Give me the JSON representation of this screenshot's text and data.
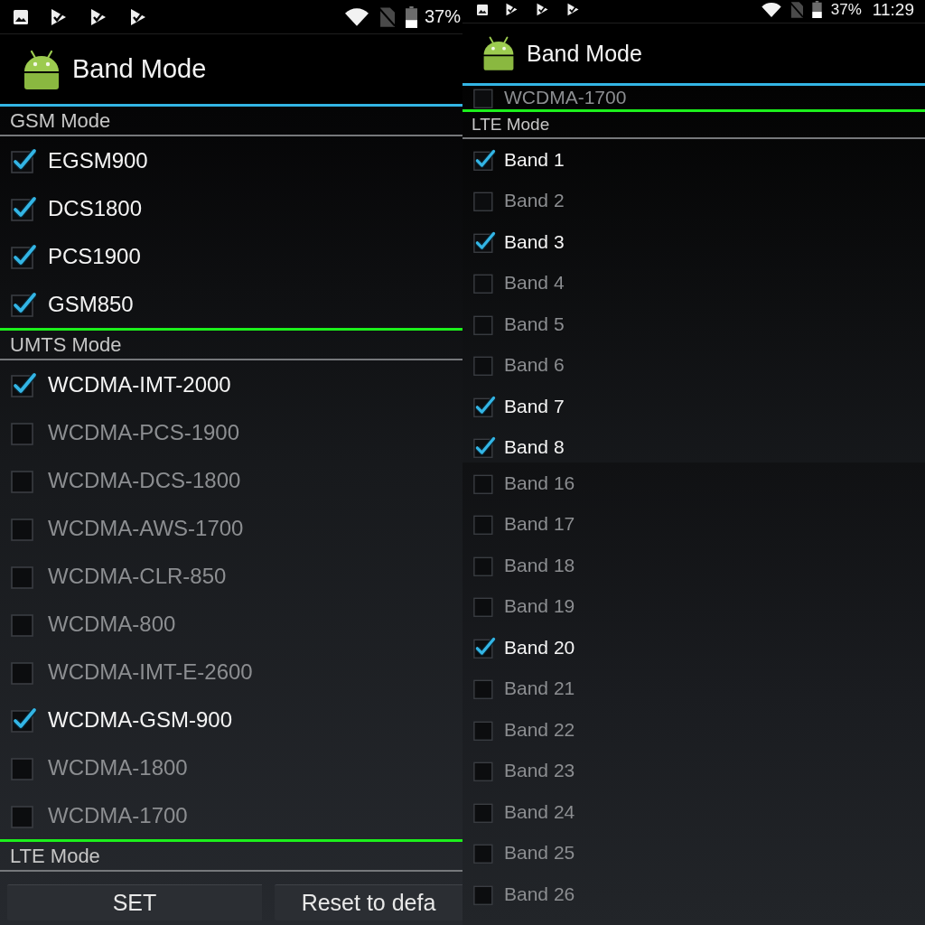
{
  "panels": [
    {
      "screens": [
        {
          "status_bar": {
            "battery": "37%"
          },
          "app_bar": {
            "title": "Band Mode"
          },
          "sections": [
            {
              "title": "GSM Mode",
              "items": [
                {
                  "label": "EGSM900",
                  "checked": true
                },
                {
                  "label": "DCS1800",
                  "checked": true
                },
                {
                  "label": "PCS1900",
                  "checked": true
                },
                {
                  "label": "GSM850",
                  "checked": true
                }
              ]
            },
            {
              "title": "UMTS Mode",
              "items": [
                {
                  "label": "WCDMA-IMT-2000",
                  "checked": true
                },
                {
                  "label": "WCDMA-PCS-1900",
                  "checked": false
                },
                {
                  "label": "WCDMA-DCS-1800",
                  "checked": false
                },
                {
                  "label": "WCDMA-AWS-1700",
                  "checked": false
                },
                {
                  "label": "WCDMA-CLR-850",
                  "checked": false
                },
                {
                  "label": "WCDMA-800",
                  "checked": false
                },
                {
                  "label": "WCDMA-IMT-E-2600",
                  "checked": false
                },
                {
                  "label": "WCDMA-GSM-900",
                  "checked": true
                },
                {
                  "label": "WCDMA-1800",
                  "checked": false
                },
                {
                  "label": "WCDMA-1700",
                  "checked": false
                }
              ]
            },
            {
              "title": "LTE Mode"
            }
          ],
          "buttons": [
            {
              "label": "SET"
            },
            {
              "label": "Reset to defa"
            }
          ]
        }
      ]
    },
    {
      "screens": [
        {
          "status_bar": {
            "battery": "37%",
            "time": "11:29"
          },
          "app_bar": {
            "title": "Band Mode"
          },
          "sections": [
            {
              "items": [
                {
                  "label": "WCDMA-1700",
                  "checked": false
                }
              ]
            },
            {
              "title": "LTE Mode",
              "items": [
                {
                  "label": "Band 1",
                  "checked": true
                },
                {
                  "label": "Band 2",
                  "checked": false
                },
                {
                  "label": "Band 3",
                  "checked": true
                },
                {
                  "label": "Band 4",
                  "checked": false
                },
                {
                  "label": "Band 5",
                  "checked": false
                },
                {
                  "label": "Band 6",
                  "checked": false
                },
                {
                  "label": "Band 7",
                  "checked": true
                },
                {
                  "label": "Band 8",
                  "checked": true
                }
              ]
            }
          ]
        },
        {
          "sections": [
            {
              "items": [
                {
                  "label": "Band 16",
                  "checked": false
                },
                {
                  "label": "Band 17",
                  "checked": false
                },
                {
                  "label": "Band 18",
                  "checked": false
                },
                {
                  "label": "Band 19",
                  "checked": false
                },
                {
                  "label": "Band 20",
                  "checked": true
                },
                {
                  "label": "Band 21",
                  "checked": false
                },
                {
                  "label": "Band 22",
                  "checked": false
                },
                {
                  "label": "Band 23",
                  "checked": false
                },
                {
                  "label": "Band 24",
                  "checked": false
                },
                {
                  "label": "Band 25",
                  "checked": false
                },
                {
                  "label": "Band 26",
                  "checked": false
                }
              ]
            }
          ]
        }
      ]
    }
  ]
}
